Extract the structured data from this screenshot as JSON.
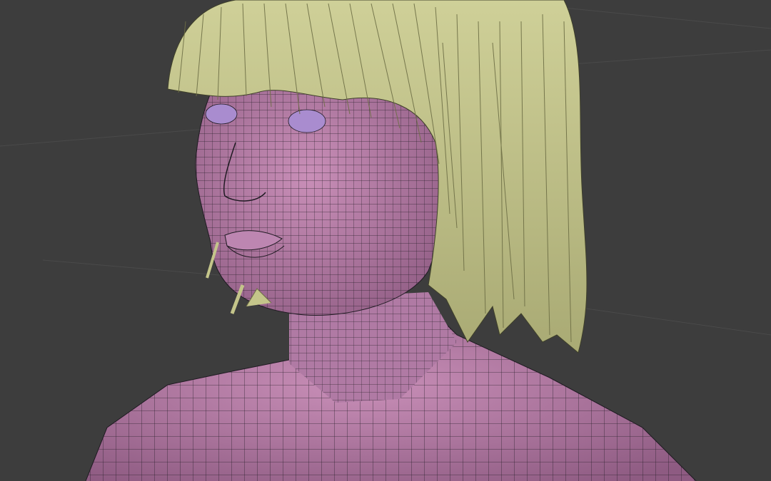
{
  "viewport": {
    "background_color": "#3d3d3d",
    "grid_line_color": "#4a4a4a",
    "mode": "wireframe-overlay"
  },
  "model": {
    "skin_color": "#a36b95",
    "skin_highlight": "#c98fb8",
    "eye_color": "#a98ccf",
    "wire_color": "#1f1a22",
    "hair_color": "#c4c58a",
    "hair_shadow": "#8f9060"
  }
}
